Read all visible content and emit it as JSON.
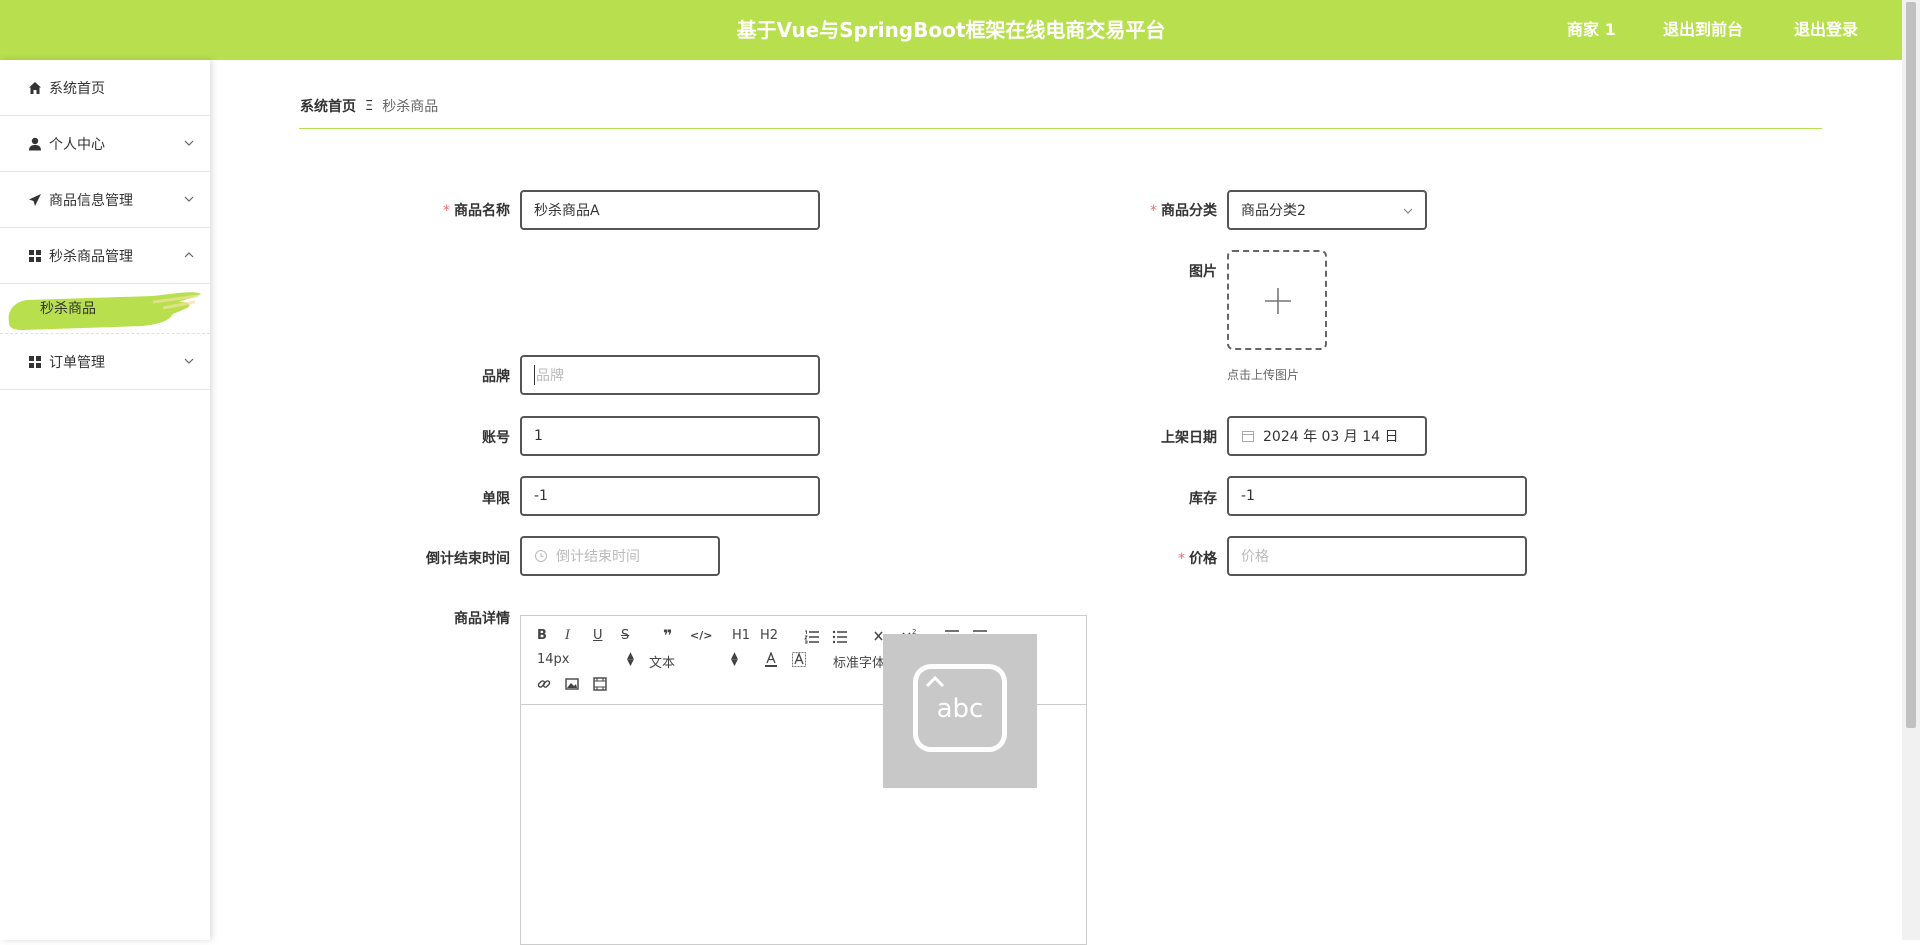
{
  "header": {
    "title": "基于Vue与SpringBoot框架在线电商交易平台",
    "nav": [
      "商家 1",
      "退出到前台",
      "退出登录"
    ]
  },
  "sidebar": {
    "items": [
      {
        "label": "系统首页",
        "icon": "home-icon"
      },
      {
        "label": "个人中心",
        "icon": "user-icon"
      },
      {
        "label": "商品信息管理",
        "icon": "send-icon"
      },
      {
        "label": "秒杀商品管理",
        "icon": "grid-icon",
        "expanded": true
      },
      {
        "label": "订单管理",
        "icon": "grid-icon"
      }
    ],
    "sub_active": "秒杀商品"
  },
  "breadcrumb": {
    "home": "系统首页",
    "sep": "Ξ",
    "current": "秒杀商品"
  },
  "form": {
    "name": {
      "label": "商品名称",
      "value": "秒杀商品A"
    },
    "category": {
      "label": "商品分类",
      "value": "商品分类2"
    },
    "image": {
      "label": "图片",
      "tip": "点击上传图片"
    },
    "brand": {
      "label": "品牌",
      "placeholder": "品牌"
    },
    "account": {
      "label": "账号",
      "value": "1"
    },
    "date": {
      "label": "上架日期",
      "value": "2024 年 03 月 14 日"
    },
    "limit": {
      "label": "单限",
      "value": "-1"
    },
    "stock": {
      "label": "库存",
      "value": "-1"
    },
    "countdown": {
      "label": "倒计结束时间",
      "placeholder": "倒计结束时间"
    },
    "price": {
      "label": "价格",
      "placeholder": "价格"
    },
    "detail": {
      "label": "商品详情"
    }
  },
  "editor": {
    "size": "14px",
    "heading": "文本",
    "font": "标准字体",
    "buttons": [
      "B",
      "I",
      "U",
      "S",
      "❞",
      "</>",
      "H1",
      "H2"
    ]
  },
  "ime": {
    "text": "abc"
  },
  "colors": {
    "accent": "#b8df4d",
    "required": "#f56c6c"
  }
}
